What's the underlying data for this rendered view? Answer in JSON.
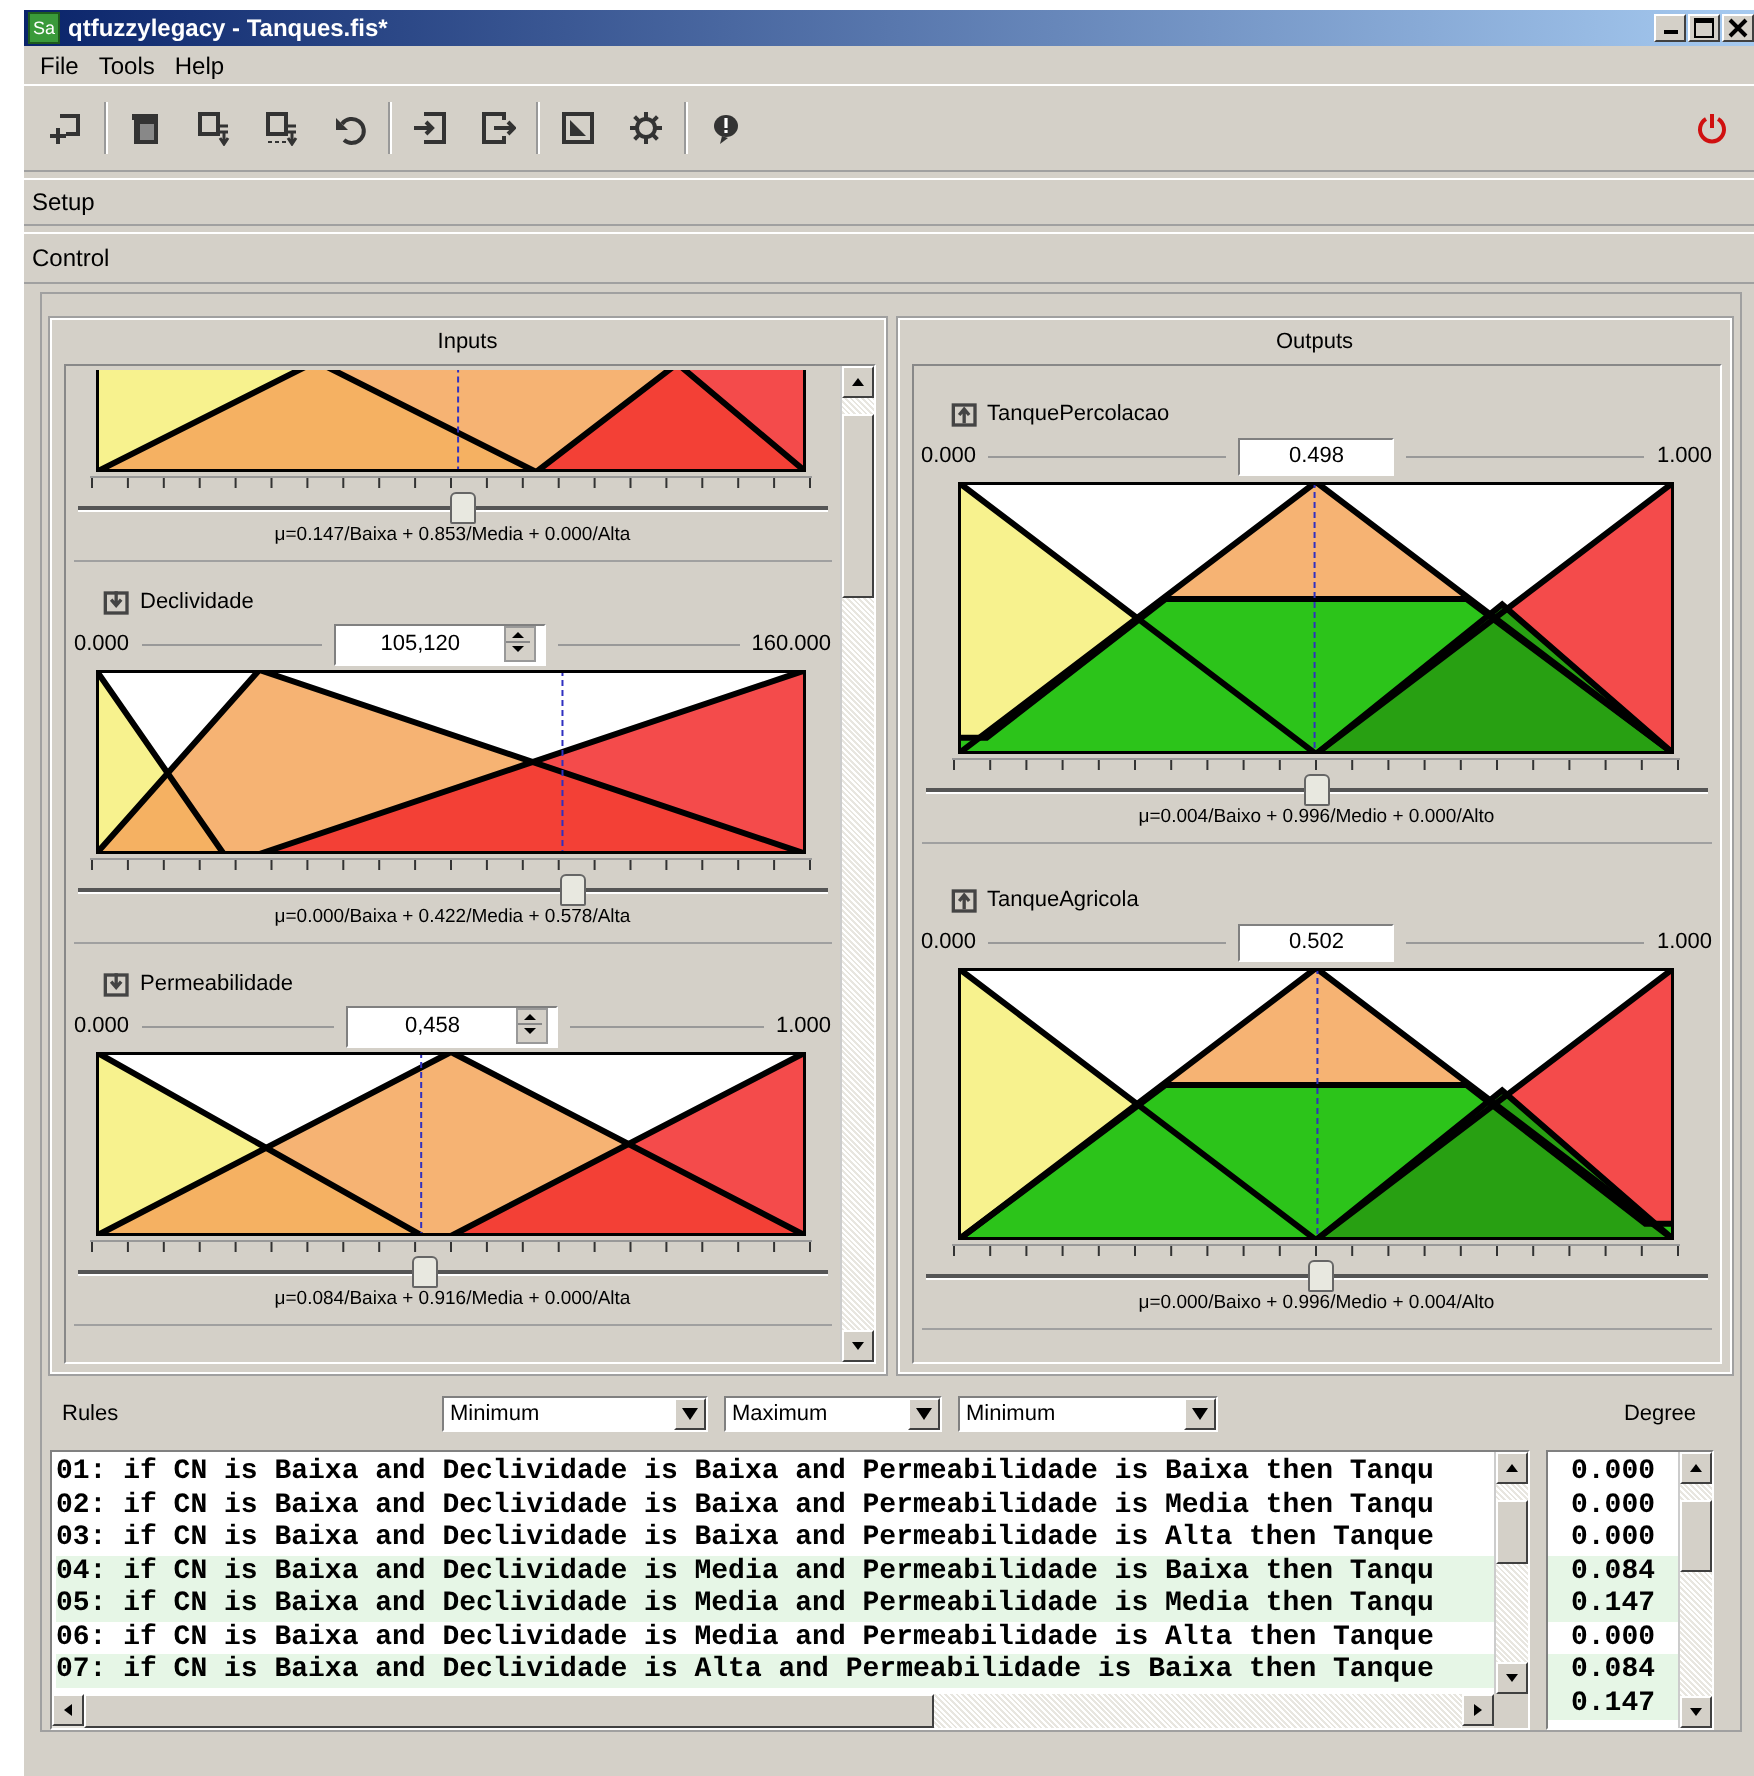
{
  "window": {
    "title": "qtfuzzylegacy - Tanques.fis*",
    "app_icon": "Sa"
  },
  "menu": [
    "File",
    "Tools",
    "Help"
  ],
  "sections": [
    {
      "label": "Setup"
    },
    {
      "label": "Control"
    }
  ],
  "inputs": {
    "title": "Inputs",
    "variables": [
      {
        "kind": "input",
        "level": 0.51,
        "membership": "μ=0.147/Baixa + 0.853/Media + 0.000/Alta"
      },
      {
        "kind": "input",
        "name": "Declividade",
        "min": "0.000",
        "max": "160.000",
        "value": "105,120",
        "level": 0.657,
        "membership": "μ=0.000/Baixa + 0.422/Media + 0.578/Alta"
      },
      {
        "kind": "input",
        "name": "Permeabilidade",
        "min": "0.000",
        "max": "1.000",
        "value": "0,458",
        "level": 0.458,
        "membership": "μ=0.084/Baixa + 0.916/Media + 0.000/Alta"
      }
    ]
  },
  "outputs": {
    "title": "Outputs",
    "variables": [
      {
        "kind": "output",
        "name": "TanquePercolacao",
        "min": "0.000",
        "max": "1.000",
        "value": "0.498",
        "level": 0.498,
        "membership": "μ=0.004/Baixo + 0.996/Medio + 0.000/Alto"
      },
      {
        "kind": "output",
        "name": "TanqueAgricola",
        "min": "0.000",
        "max": "1.000",
        "value": "0.502",
        "level": 0.502,
        "membership": "μ=0.000/Baixo + 0.996/Medio + 0.004/Alto"
      }
    ]
  },
  "rules": {
    "label": "Rules",
    "operators": [
      "Minimum",
      "Maximum",
      "Minimum"
    ],
    "degree_label": "Degree",
    "lines": [
      {
        "text": "01: if CN is Baixa and Declividade is Baixa and Permeabilidade is Baixa then Tanqu",
        "active": false
      },
      {
        "text": "02: if CN is Baixa and Declividade is Baixa and Permeabilidade is Media then Tanqu",
        "active": false
      },
      {
        "text": "03: if CN is Baixa and Declividade is Baixa and Permeabilidade is Alta then Tanque",
        "active": false
      },
      {
        "text": "04: if CN is Baixa and Declividade is Media and Permeabilidade is Baixa then Tanqu",
        "active": true
      },
      {
        "text": "05: if CN is Baixa and Declividade is Media and Permeabilidade is Media then Tanqu",
        "active": true
      },
      {
        "text": "06: if CN is Baixa and Declividade is Media and Permeabilidade is Alta then Tanque",
        "active": false
      },
      {
        "text": "07: if CN is Baixa and Declividade is Alta and Permeabilidade is Baixa then Tanque",
        "active": true
      }
    ],
    "degrees": [
      {
        "value": "0.000",
        "active": false
      },
      {
        "value": "0.000",
        "active": false
      },
      {
        "value": "0.000",
        "active": false
      },
      {
        "value": "0.084",
        "active": true
      },
      {
        "value": "0.147",
        "active": true
      },
      {
        "value": "0.000",
        "active": false
      },
      {
        "value": "0.084",
        "active": true
      },
      {
        "value": "0.147",
        "active": true
      }
    ]
  }
}
